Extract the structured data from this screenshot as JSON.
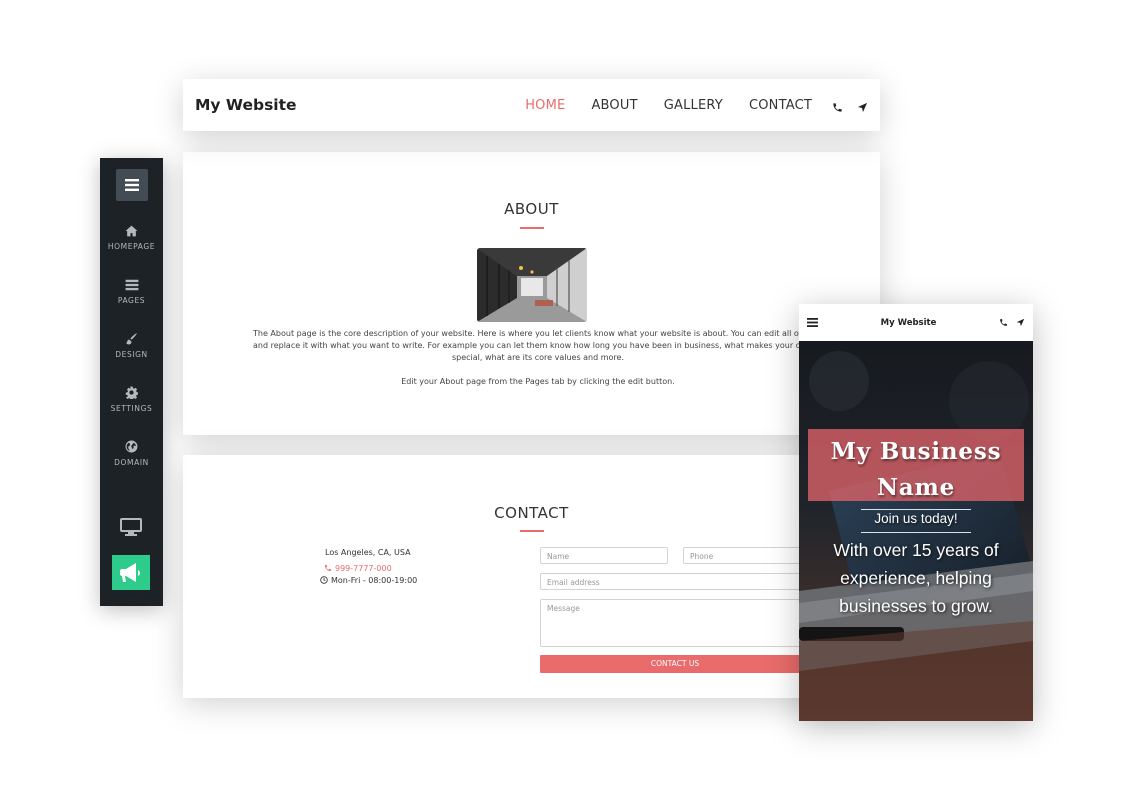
{
  "site": {
    "title": "My Website",
    "nav": [
      "HOME",
      "ABOUT",
      "GALLERY",
      "CONTACT"
    ],
    "active_nav": "HOME",
    "accent_color": "#e96b6b"
  },
  "about": {
    "heading": "ABOUT",
    "lines": [
      "The About page is the core description of your website. Here is where you let clients know what your website is about. You can edit all of this te",
      "and replace it with what you want to write. For example you can let them know how long you have been in business, what makes your compar",
      "special, what are its core values and more."
    ],
    "edit_hint": "Edit your About page from the Pages tab by clicking the edit button."
  },
  "contact": {
    "heading": "CONTACT",
    "address": "Los Angeles, CA, USA",
    "phone": "999-7777-000",
    "hours": "Mon-Fri - 08:00-19:00",
    "form": {
      "name_placeholder": "Name",
      "phone_placeholder": "Phone",
      "email_placeholder": "Email address",
      "message_placeholder": "Message",
      "submit_label": "CONTACT US"
    }
  },
  "sidebar": {
    "items": [
      {
        "label": "HOMEPAGE",
        "icon": "home-icon"
      },
      {
        "label": "PAGES",
        "icon": "pages-icon"
      },
      {
        "label": "DESIGN",
        "icon": "brush-icon"
      },
      {
        "label": "SETTINGS",
        "icon": "gear-icon"
      },
      {
        "label": "DOMAIN",
        "icon": "globe-icon"
      }
    ],
    "promo_color": "#2ecc8a"
  },
  "mobile": {
    "title": "My Website",
    "business_name_line1": "My Business",
    "business_name_line2": "Name",
    "tagline": "Join us today!",
    "description_lines": [
      "With over 15 years of",
      "experience, helping",
      "businesses to grow."
    ]
  }
}
